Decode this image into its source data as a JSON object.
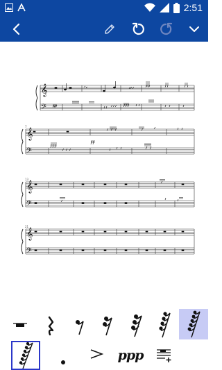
{
  "status_bar": {
    "time": "2:51",
    "icons": [
      "gallery-icon",
      "text-a-icon",
      "wifi-icon",
      "signal-icon",
      "battery-icon"
    ]
  },
  "toolbar": {
    "buttons": [
      "back-icon",
      "pencil-icon",
      "undo-icon",
      "redo-icon",
      "chevron-down-icon"
    ]
  },
  "score": {
    "measure_numbers": [
      "7",
      "13",
      "21"
    ],
    "systems": 4
  },
  "palette": {
    "items": [
      "whole-rest",
      "quarter-rest",
      "eighth-rest",
      "sixteenth-rest",
      "thirty-second-rest",
      "sixty-fourth-rest",
      "one-twenty-eighth-rest",
      "two-fifty-sixth-rest",
      "augmentation-dot",
      "accent",
      "ppp",
      "add-to-palette"
    ],
    "dynamic_label": "ppp",
    "selected_index": 7,
    "focused_index": 8
  },
  "colors": {
    "app_bar": "#0d47a1",
    "selection": "#c7cbf5",
    "focus": "#2b37c9"
  }
}
